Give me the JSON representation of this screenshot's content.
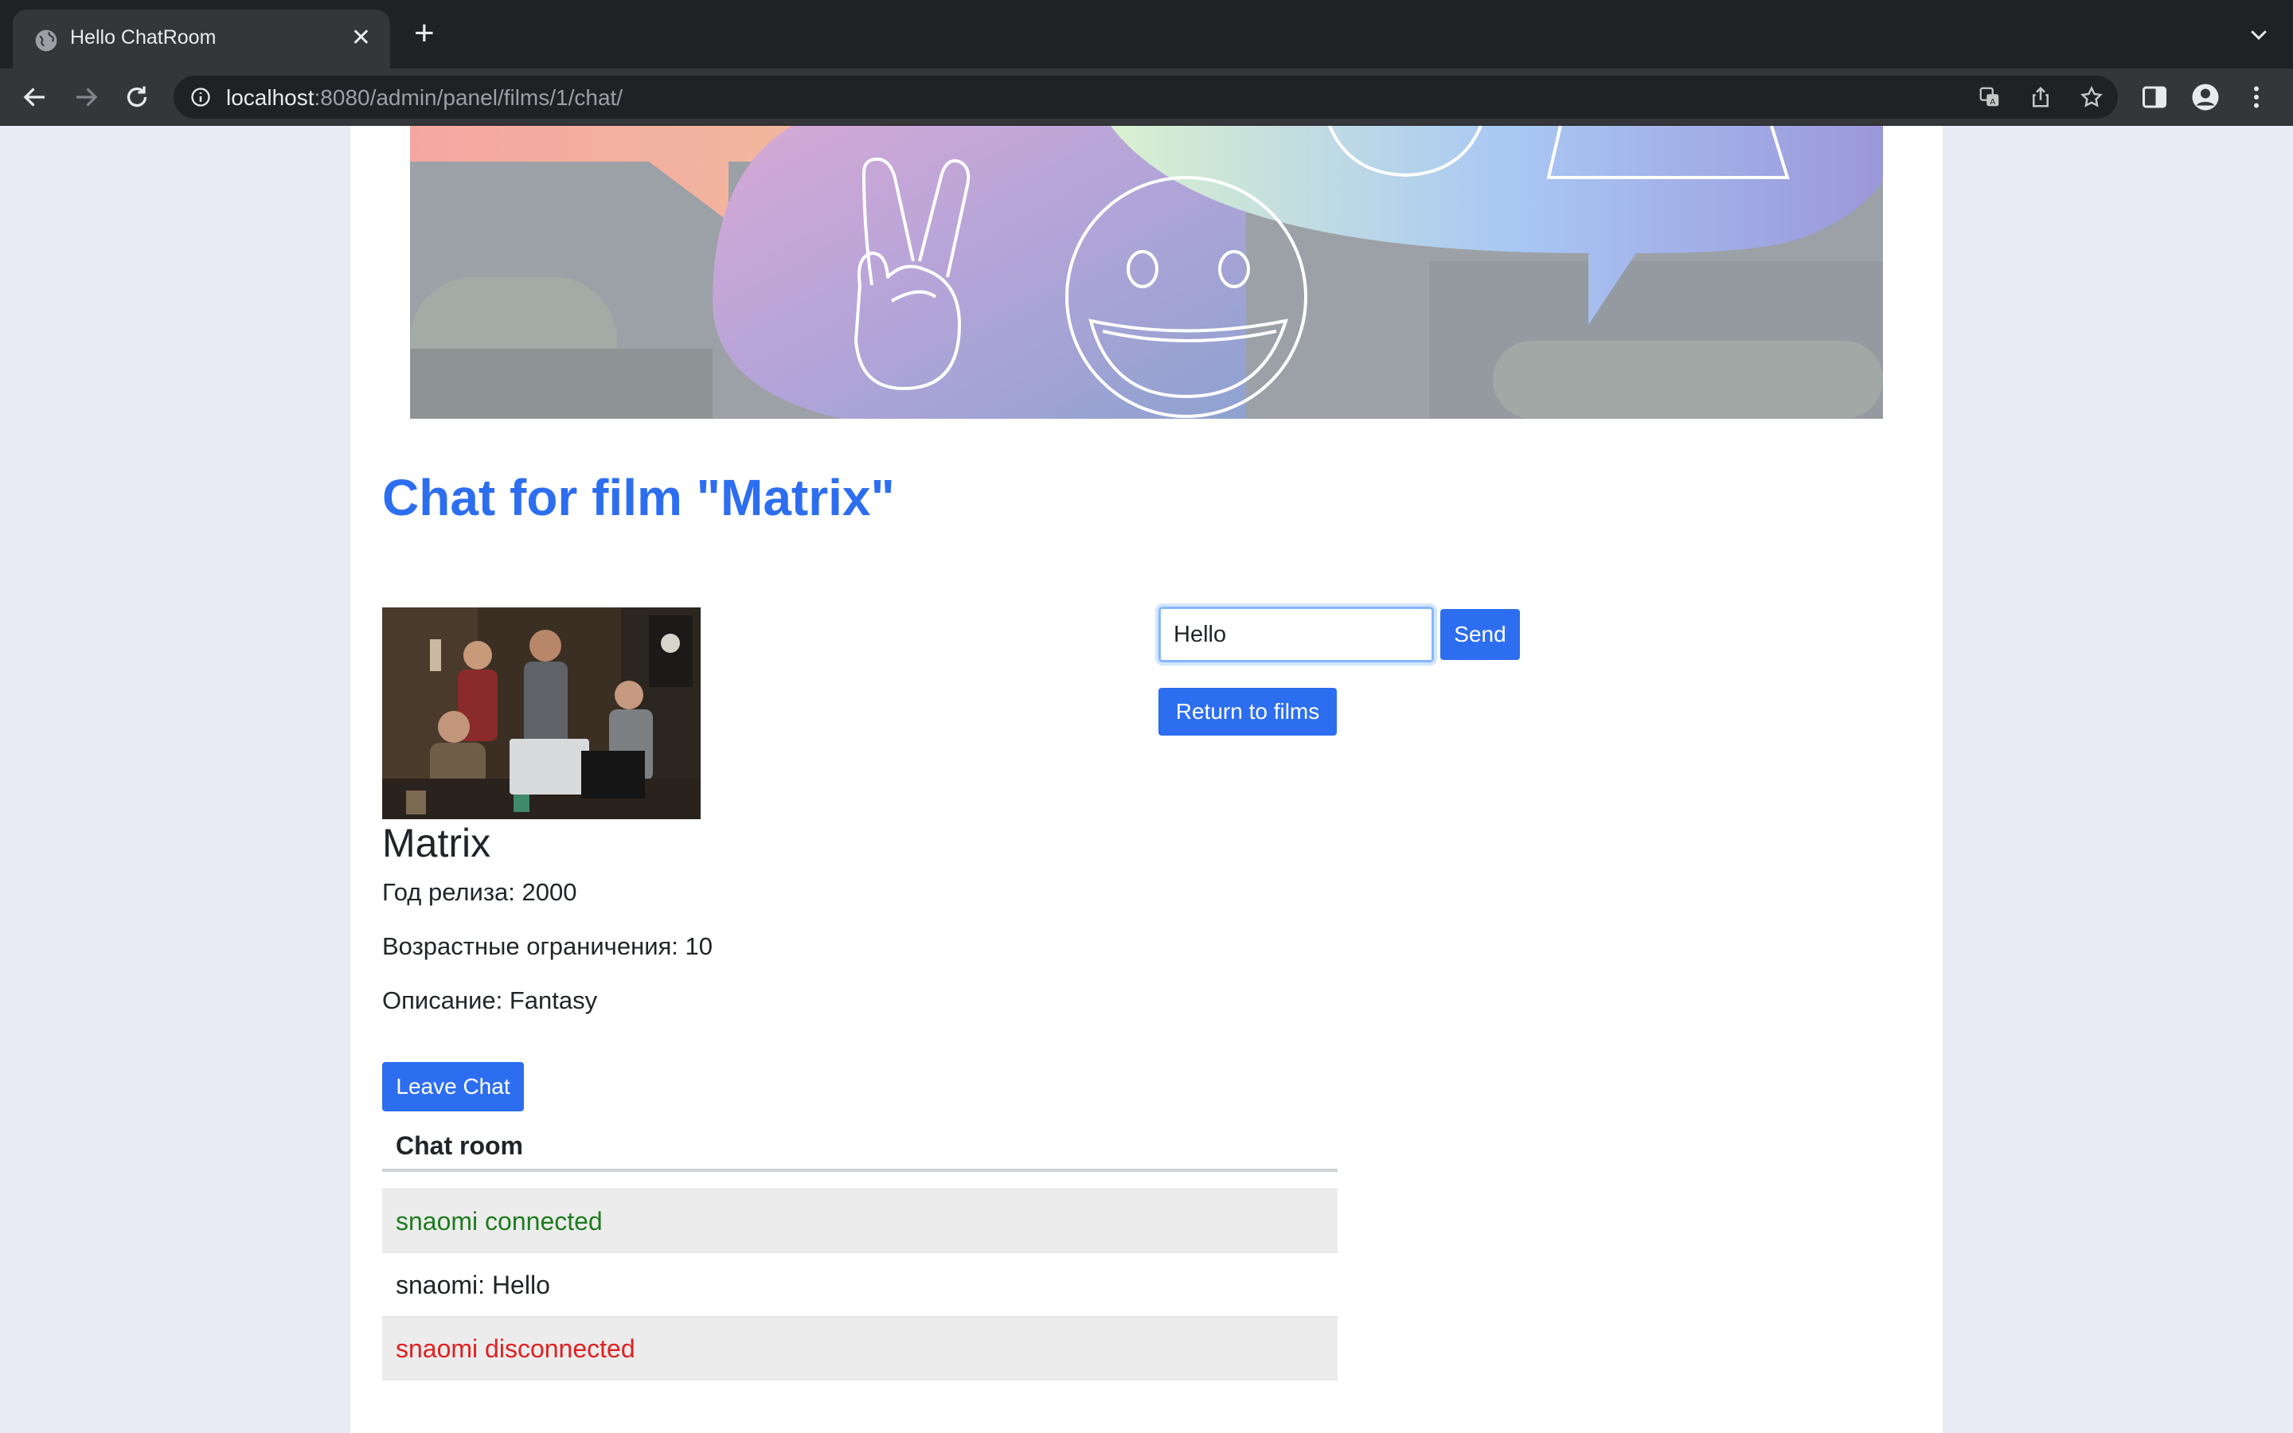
{
  "browser": {
    "tab_title": "Hello ChatRoom",
    "url_host": "localhost",
    "url_path": ":8080/admin/panel/films/1/chat/",
    "icons": [
      "globe-icon",
      "close-icon",
      "plus-icon",
      "chevron-down-icon",
      "back-arrow-icon",
      "forward-arrow-icon",
      "reload-icon",
      "info-icon",
      "translate-icon",
      "share-icon",
      "star-icon",
      "side-panel-icon",
      "profile-icon",
      "kebab-menu-icon"
    ]
  },
  "page": {
    "title": "Chat for film \"Matrix\"",
    "film": {
      "name": "Matrix",
      "release_year": "Год релиза: 2000",
      "age_rating": "Возрастные ограничения: 10",
      "description": "Описание: Fantasy"
    },
    "leave_button": "Leave Chat",
    "message_input_value": "Hello",
    "send_button": "Send",
    "return_button": "Return to films",
    "chat": {
      "header": "Chat room",
      "messages": [
        {
          "text": "snaomi connected",
          "color": "#1e7b1e"
        },
        {
          "text": "snaomi: Hello",
          "color": "#212529"
        },
        {
          "text": "snaomi disconnected",
          "color": "#e02020"
        }
      ]
    }
  },
  "colors": {
    "accent": "#2d6ef0",
    "page_background": "#e9ebf4",
    "chrome_dark": "#202124",
    "chrome_toolbar": "#35363a"
  }
}
